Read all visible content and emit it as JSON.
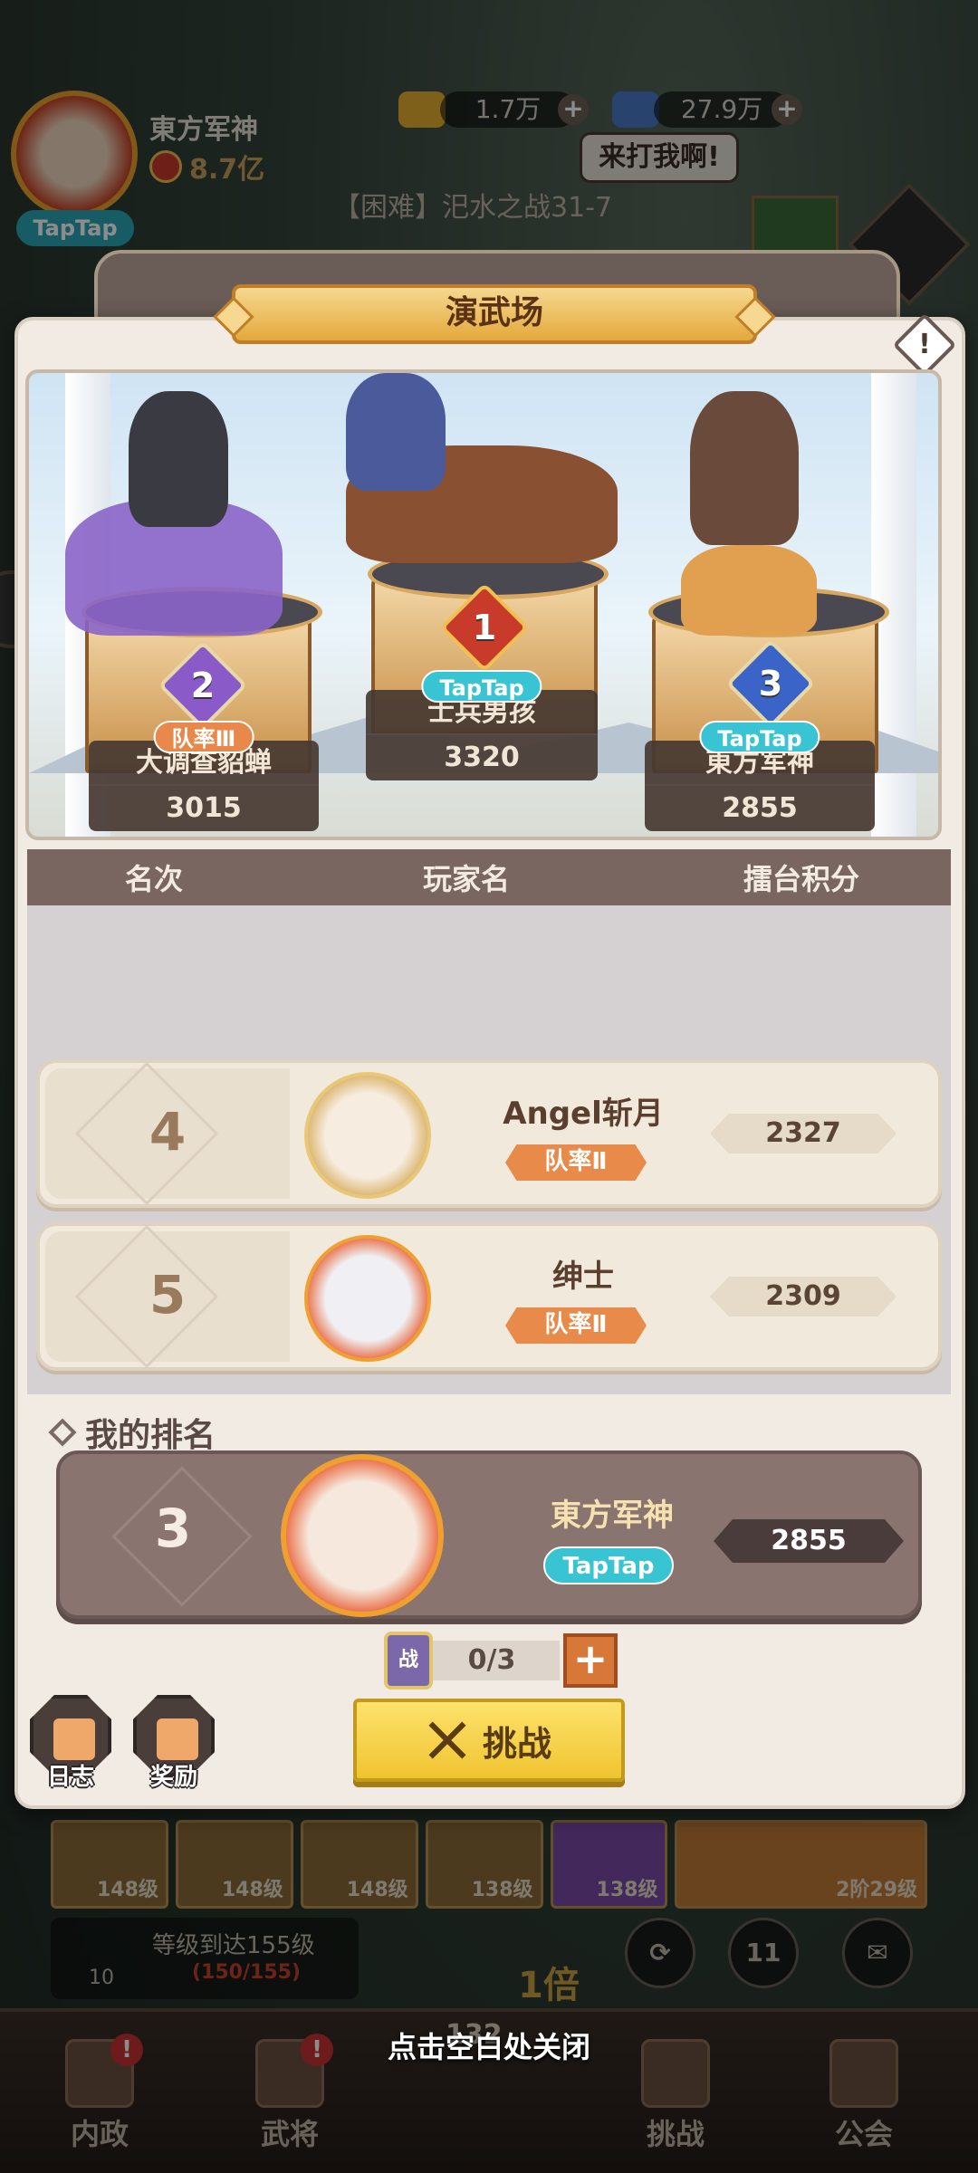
{
  "hud": {
    "player_name": "東方军神",
    "power": "8.7亿",
    "platform_tag": "TapTap",
    "gold": "1.7万",
    "gems": "27.9万",
    "speech_bubble": "来打我啊!",
    "stage": "【困难】汜水之战31-7"
  },
  "dialog": {
    "title": "演武场",
    "info_icon": "!",
    "podium": [
      {
        "rank": "2",
        "name": "大调查貂蝉",
        "score": "3015",
        "tag": "队率Ⅲ",
        "tag_type": "team"
      },
      {
        "rank": "1",
        "name": "士兵男孩",
        "score": "3320",
        "tag": "TapTap",
        "tag_type": "taptap"
      },
      {
        "rank": "3",
        "name": "東方军神",
        "score": "2855",
        "tag": "TapTap",
        "tag_type": "taptap"
      }
    ],
    "table_headers": {
      "rank": "名次",
      "player": "玩家名",
      "score": "擂台积分"
    },
    "rows": [
      {
        "rank": "4",
        "name": "Angel斩月",
        "tag": "队率Ⅱ",
        "score": "2327"
      },
      {
        "rank": "5",
        "name": "绅士",
        "tag": "队率Ⅱ",
        "score": "2309"
      }
    ],
    "my_rank_label": "我的排名",
    "my_rank": {
      "rank": "3",
      "name": "東方军神",
      "tag": "TapTap",
      "score": "2855"
    },
    "token_label": "战",
    "attempts": "0/3",
    "plus": "+",
    "challenge_label": "挑战",
    "log_label": "日志",
    "reward_label": "奖励"
  },
  "background": {
    "items": [
      "148级",
      "148级",
      "148级",
      "138级",
      "138级",
      "2阶29级"
    ],
    "quest_text": "等级到达155级",
    "quest_progress": "(150/155)",
    "quest_count": "10",
    "round_btn_number": "11",
    "multiplier": "1倍",
    "center_level": "132",
    "close_hint": "点击空白处关闭"
  },
  "nav": [
    {
      "label": "内政",
      "badge": "!"
    },
    {
      "label": "武将",
      "badge": "!"
    },
    {
      "label": "挑战",
      "badge": ""
    },
    {
      "label": "公会",
      "badge": ""
    }
  ],
  "colors": {
    "accent_gold": "#f0c430",
    "team_tag": "#e8884a",
    "taptap_tag": "#38c4d2",
    "panel_brown": "#7a6660"
  }
}
